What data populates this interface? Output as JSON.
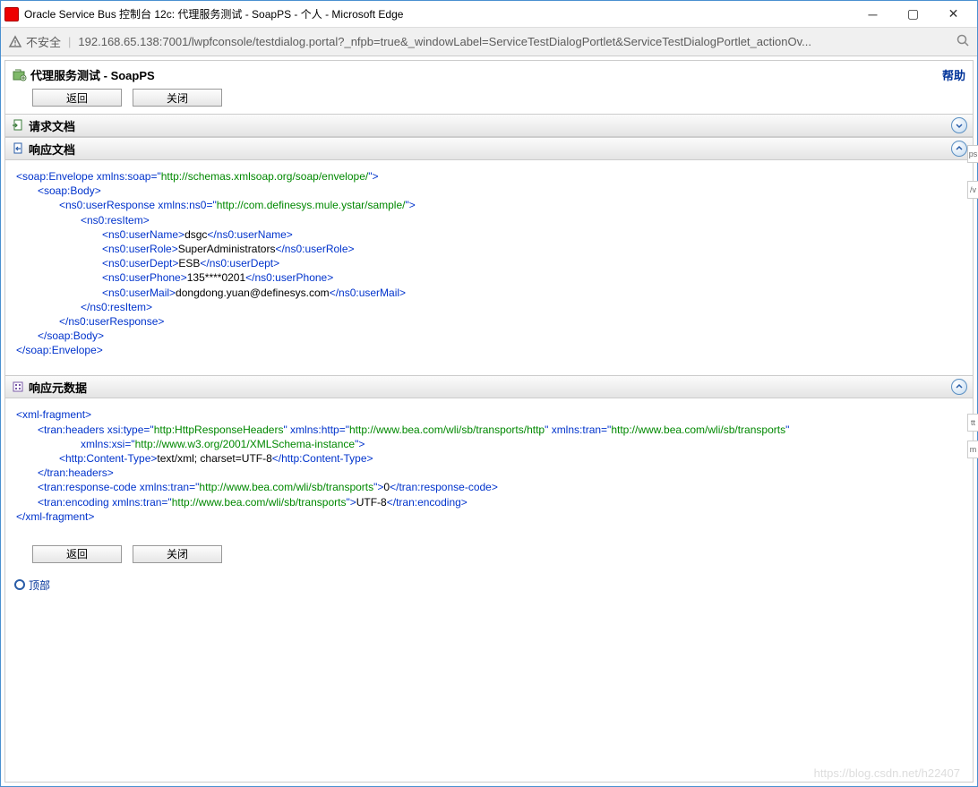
{
  "window": {
    "title": "Oracle Service Bus 控制台 12c: 代理服务测试 - SoapPS - 个人 - Microsoft Edge"
  },
  "addressbar": {
    "insecure": "不安全",
    "url": "192.168.65.138:7001/lwpfconsole/testdialog.portal?_nfpb=true&_windowLabel=ServiceTestDialogPortlet&ServiceTestDialogPortlet_actionOv..."
  },
  "page": {
    "title_prefix": "代理服务测试 - ",
    "title_name": "SoapPS",
    "help": "帮助"
  },
  "buttons": {
    "back": "返回",
    "close": "关闭"
  },
  "sections": {
    "request": "请求文档",
    "response": "响应文档",
    "metadata": "响应元数据"
  },
  "response_xml": {
    "l1_open": "<soap:Envelope ",
    "l1_attr": "xmlns:soap",
    "l1_eq": "=\"",
    "l1_url": "http://schemas.xmlsoap.org/soap/envelope/",
    "l1_end": "\">",
    "l2": "<soap:Body>",
    "l3_open": "<ns0:userResponse ",
    "l3_attr": "xmlns:ns0",
    "l3_eq": "=\"",
    "l3_url": "http://com.definesys.mule.ystar/sample/",
    "l3_end": "\">",
    "l4": "<ns0:resItem>",
    "l5a": "<ns0:userName>",
    "l5b": "dsgc",
    "l5c": "</ns0:userName>",
    "l6a": "<ns0:userRole>",
    "l6b": "SuperAdministrators",
    "l6c": "</ns0:userRole>",
    "l7a": "<ns0:userDept>",
    "l7b": "ESB",
    "l7c": "</ns0:userDept>",
    "l8a": "<ns0:userPhone>",
    "l8b": "135****0201",
    "l8c": "</ns0:userPhone>",
    "l9a": "<ns0:userMail>",
    "l9b": "dongdong.yuan@definesys.com",
    "l9c": "</ns0:userMail>",
    "l10": "</ns0:resItem>",
    "l11": "</ns0:userResponse>",
    "l12": "</soap:Body>",
    "l13": "</soap:Envelope>"
  },
  "meta_xml": {
    "l1": "<xml-fragment>",
    "l2a": "<tran:headers ",
    "l2b": "xsi:type",
    "l2c": "=\"",
    "l2d": "http:HttpResponseHeaders",
    "l2e": "\" ",
    "l2f": "xmlns:http",
    "l2g": "=\"",
    "l2h": "http://www.bea.com/wli/sb/transports/http",
    "l2i": "\" ",
    "l2j": "xmlns:tran",
    "l2k": "=\"",
    "l2l": "http://www.bea.com/wli/sb/transports",
    "l2m": "\"",
    "l3a": "xmlns:xsi",
    "l3b": "=\"",
    "l3c": "http://www.w3.org/2001/XMLSchema-instance",
    "l3d": "\">",
    "l4a": "<http:Content-Type>",
    "l4b": "text/xml; charset=UTF-8",
    "l4c": "</http:Content-Type>",
    "l5": "</tran:headers>",
    "l6a": "<tran:response-code ",
    "l6b": "xmlns:tran",
    "l6c": "=\"",
    "l6d": "http://www.bea.com/wli/sb/transports",
    "l6e": "\">",
    "l6f": "0",
    "l6g": "</tran:response-code>",
    "l7a": "<tran:encoding ",
    "l7b": "xmlns:tran",
    "l7c": "=\"",
    "l7d": "http://www.bea.com/wli/sb/transports",
    "l7e": "\">",
    "l7f": "UTF-8",
    "l7g": "</tran:encoding>",
    "l8": "</xml-fragment>"
  },
  "footer": {
    "top": "顶部"
  },
  "side": {
    "t1": "ps",
    "t2": "/v",
    "t3": "tt",
    "t4": "m"
  },
  "watermark": "https://blog.csdn.net/h22407"
}
